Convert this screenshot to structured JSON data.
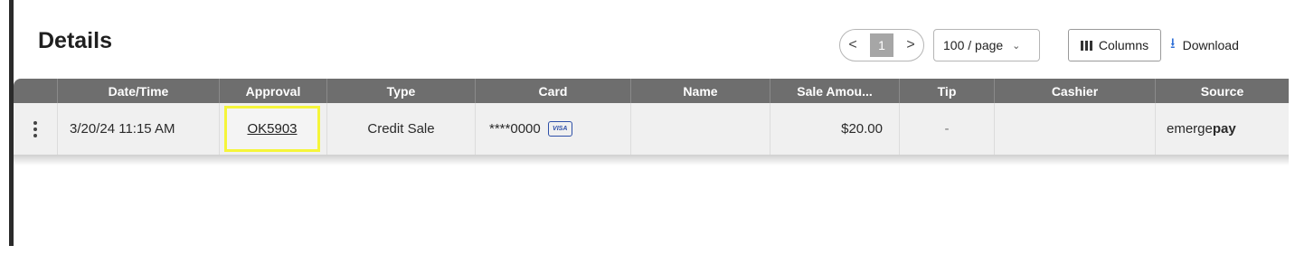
{
  "header": {
    "title": "Details"
  },
  "pagination": {
    "prev": "<",
    "page": "1",
    "next": ">",
    "page_size": "100 / page"
  },
  "toolbar": {
    "columns_label": "Columns",
    "download_label": "Download"
  },
  "table": {
    "columns": [
      "Date/Time",
      "Approval",
      "Type",
      "Card",
      "Name",
      "Sale Amou...",
      "Tip",
      "Cashier",
      "Source"
    ],
    "rows": [
      {
        "datetime": "3/20/24 11:15 AM",
        "approval": "OK5903",
        "type": "Credit Sale",
        "card": "****0000",
        "card_brand": "VISA",
        "name": "",
        "sale_amount": "$20.00",
        "tip": "-",
        "cashier": "",
        "source_prefix": "emerge",
        "source_suffix": "pay"
      }
    ]
  },
  "colors": {
    "header_bg": "#6e6e6e",
    "highlight": "#f5f53a",
    "download_icon": "#2f6fd6",
    "visa_blue": "#2d4fa8"
  }
}
